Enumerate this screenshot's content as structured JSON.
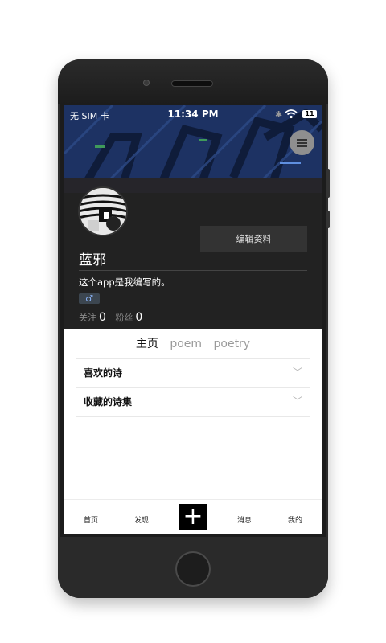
{
  "status_bar": {
    "carrier": "无 SIM 卡",
    "time": "11:34 PM",
    "bluetooth_icon": "bluetooth-icon",
    "wifi_icon": "wifi-icon",
    "battery": "11"
  },
  "profile": {
    "edit_button": "编辑资料",
    "username": "蓝邪",
    "bio": "这个app是我编写的。",
    "gender_symbol": "♂",
    "following_label": "关注",
    "following_count": "0",
    "followers_label": "粉丝",
    "followers_count": "0"
  },
  "tabs": [
    {
      "label": "主页",
      "active": true
    },
    {
      "label": "poem",
      "active": false
    },
    {
      "label": "poetry",
      "active": false
    }
  ],
  "sections": [
    {
      "label": "喜欢的诗"
    },
    {
      "label": "收藏的诗集"
    }
  ],
  "bottom_nav": {
    "home": "首页",
    "discover": "发现",
    "add": "+",
    "messages": "消息",
    "mine": "我的"
  },
  "colors": {
    "header_bg": "#222222",
    "cover_blue": "#1e3566",
    "accent_black": "#000000"
  }
}
